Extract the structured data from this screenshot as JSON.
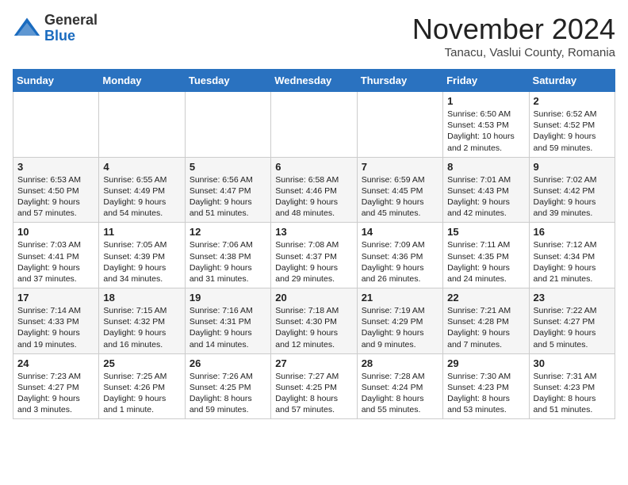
{
  "header": {
    "logo_line1": "General",
    "logo_line2": "Blue",
    "month_title": "November 2024",
    "location": "Tanacu, Vaslui County, Romania"
  },
  "days_of_week": [
    "Sunday",
    "Monday",
    "Tuesday",
    "Wednesday",
    "Thursday",
    "Friday",
    "Saturday"
  ],
  "weeks": [
    [
      {
        "day": "",
        "info": ""
      },
      {
        "day": "",
        "info": ""
      },
      {
        "day": "",
        "info": ""
      },
      {
        "day": "",
        "info": ""
      },
      {
        "day": "",
        "info": ""
      },
      {
        "day": "1",
        "info": "Sunrise: 6:50 AM\nSunset: 4:53 PM\nDaylight: 10 hours and 2 minutes."
      },
      {
        "day": "2",
        "info": "Sunrise: 6:52 AM\nSunset: 4:52 PM\nDaylight: 9 hours and 59 minutes."
      }
    ],
    [
      {
        "day": "3",
        "info": "Sunrise: 6:53 AM\nSunset: 4:50 PM\nDaylight: 9 hours and 57 minutes."
      },
      {
        "day": "4",
        "info": "Sunrise: 6:55 AM\nSunset: 4:49 PM\nDaylight: 9 hours and 54 minutes."
      },
      {
        "day": "5",
        "info": "Sunrise: 6:56 AM\nSunset: 4:47 PM\nDaylight: 9 hours and 51 minutes."
      },
      {
        "day": "6",
        "info": "Sunrise: 6:58 AM\nSunset: 4:46 PM\nDaylight: 9 hours and 48 minutes."
      },
      {
        "day": "7",
        "info": "Sunrise: 6:59 AM\nSunset: 4:45 PM\nDaylight: 9 hours and 45 minutes."
      },
      {
        "day": "8",
        "info": "Sunrise: 7:01 AM\nSunset: 4:43 PM\nDaylight: 9 hours and 42 minutes."
      },
      {
        "day": "9",
        "info": "Sunrise: 7:02 AM\nSunset: 4:42 PM\nDaylight: 9 hours and 39 minutes."
      }
    ],
    [
      {
        "day": "10",
        "info": "Sunrise: 7:03 AM\nSunset: 4:41 PM\nDaylight: 9 hours and 37 minutes."
      },
      {
        "day": "11",
        "info": "Sunrise: 7:05 AM\nSunset: 4:39 PM\nDaylight: 9 hours and 34 minutes."
      },
      {
        "day": "12",
        "info": "Sunrise: 7:06 AM\nSunset: 4:38 PM\nDaylight: 9 hours and 31 minutes."
      },
      {
        "day": "13",
        "info": "Sunrise: 7:08 AM\nSunset: 4:37 PM\nDaylight: 9 hours and 29 minutes."
      },
      {
        "day": "14",
        "info": "Sunrise: 7:09 AM\nSunset: 4:36 PM\nDaylight: 9 hours and 26 minutes."
      },
      {
        "day": "15",
        "info": "Sunrise: 7:11 AM\nSunset: 4:35 PM\nDaylight: 9 hours and 24 minutes."
      },
      {
        "day": "16",
        "info": "Sunrise: 7:12 AM\nSunset: 4:34 PM\nDaylight: 9 hours and 21 minutes."
      }
    ],
    [
      {
        "day": "17",
        "info": "Sunrise: 7:14 AM\nSunset: 4:33 PM\nDaylight: 9 hours and 19 minutes."
      },
      {
        "day": "18",
        "info": "Sunrise: 7:15 AM\nSunset: 4:32 PM\nDaylight: 9 hours and 16 minutes."
      },
      {
        "day": "19",
        "info": "Sunrise: 7:16 AM\nSunset: 4:31 PM\nDaylight: 9 hours and 14 minutes."
      },
      {
        "day": "20",
        "info": "Sunrise: 7:18 AM\nSunset: 4:30 PM\nDaylight: 9 hours and 12 minutes."
      },
      {
        "day": "21",
        "info": "Sunrise: 7:19 AM\nSunset: 4:29 PM\nDaylight: 9 hours and 9 minutes."
      },
      {
        "day": "22",
        "info": "Sunrise: 7:21 AM\nSunset: 4:28 PM\nDaylight: 9 hours and 7 minutes."
      },
      {
        "day": "23",
        "info": "Sunrise: 7:22 AM\nSunset: 4:27 PM\nDaylight: 9 hours and 5 minutes."
      }
    ],
    [
      {
        "day": "24",
        "info": "Sunrise: 7:23 AM\nSunset: 4:27 PM\nDaylight: 9 hours and 3 minutes."
      },
      {
        "day": "25",
        "info": "Sunrise: 7:25 AM\nSunset: 4:26 PM\nDaylight: 9 hours and 1 minute."
      },
      {
        "day": "26",
        "info": "Sunrise: 7:26 AM\nSunset: 4:25 PM\nDaylight: 8 hours and 59 minutes."
      },
      {
        "day": "27",
        "info": "Sunrise: 7:27 AM\nSunset: 4:25 PM\nDaylight: 8 hours and 57 minutes."
      },
      {
        "day": "28",
        "info": "Sunrise: 7:28 AM\nSunset: 4:24 PM\nDaylight: 8 hours and 55 minutes."
      },
      {
        "day": "29",
        "info": "Sunrise: 7:30 AM\nSunset: 4:23 PM\nDaylight: 8 hours and 53 minutes."
      },
      {
        "day": "30",
        "info": "Sunrise: 7:31 AM\nSunset: 4:23 PM\nDaylight: 8 hours and 51 minutes."
      }
    ]
  ]
}
